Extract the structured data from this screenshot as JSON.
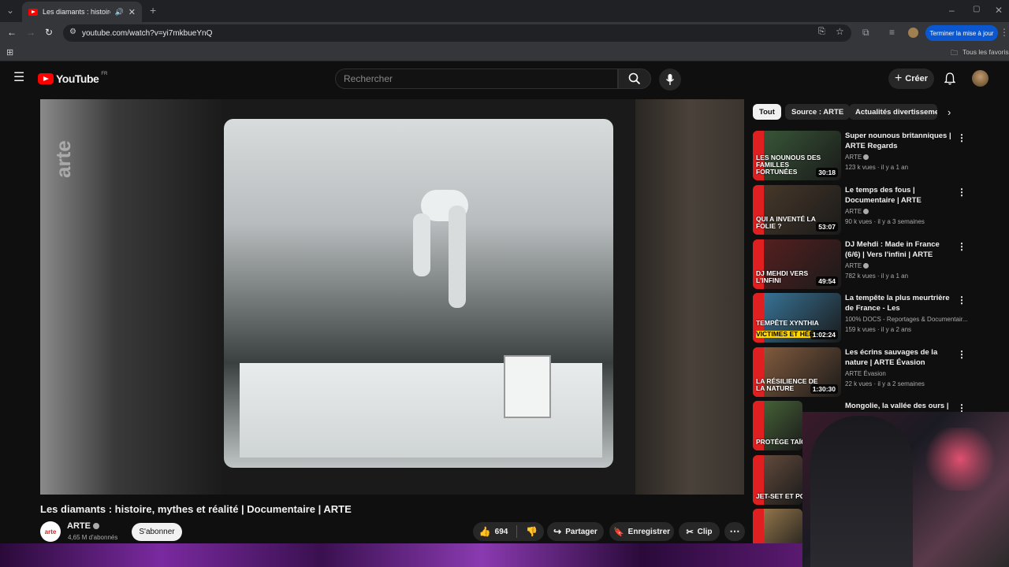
{
  "browser": {
    "tab_title": "Les diamants : histoire, myth",
    "url": "youtube.com/watch?v=yi7mkbueYnQ",
    "update_label": "Terminer la mise à jour",
    "bookmarks_label": "Tous les favoris"
  },
  "header": {
    "logo_text": "YouTube",
    "logo_region": "FR",
    "search_placeholder": "Rechercher",
    "create_label": "Créer"
  },
  "video": {
    "watermark": "arte",
    "title": "Les diamants : histoire, mythes et réalité | Documentaire | ARTE",
    "channel_name": "ARTE",
    "channel_avatar_text": "arte",
    "subscribers": "4,65 M d'abonnés",
    "subscribe_label": "S'abonner",
    "likes": "694",
    "share_label": "Partager",
    "save_label": "Enregistrer",
    "clip_label": "Clip"
  },
  "chips": [
    "Tout",
    "Source : ARTE",
    "Actualités divertissement"
  ],
  "recommendations": [
    {
      "title": "Super nounous britanniques | ARTE Regards",
      "channel": "ARTE",
      "verified": true,
      "meta": "123 k vues · il y a 1 an",
      "duration": "30:18",
      "overlay": "LES NOUNOUS DES FAMILLES FORTUNÉES",
      "bg": "#3a5a3a"
    },
    {
      "title": "Le temps des fous | Documentaire | ARTE",
      "channel": "ARTE",
      "verified": true,
      "meta": "90 k vues · il y a 3 semaines",
      "duration": "53:07",
      "overlay": "QUI A INVENTÉ LA FOLIE ?",
      "bg": "#4a3a2a"
    },
    {
      "title": "DJ Mehdi : Made in France (6/6) | Vers l'infini | ARTE",
      "channel": "ARTE",
      "verified": true,
      "meta": "782 k vues · il y a 1 an",
      "duration": "49:54",
      "overlay": "DJ MEHDI VERS L'INFINI",
      "bg": "#5a2020"
    },
    {
      "title": "La tempête la plus meurtrière de France - Les conséquences...",
      "channel": "100% DOCS - Reportages & Documentair...",
      "verified": false,
      "meta": "159 k vues · il y a 2 ans",
      "duration": "1:02:24",
      "overlay": "TEMPÊTE XYNTHIA",
      "overlay2": "VICTIMES ET HÉR",
      "bg": "#3a7aa0"
    },
    {
      "title": "Les écrins sauvages de la nature | ARTE Évasion",
      "channel": "ARTE Évasion",
      "verified": false,
      "meta": "22 k vues · il y a 2 semaines",
      "duration": "1:30:30",
      "overlay": "LA RÉSILIENCE DE LA NATURE",
      "bg": "#8a6040"
    },
    {
      "title": "Mongolie, la vallée des ours |",
      "channel": "",
      "verified": false,
      "meta": "",
      "duration": "",
      "overlay": "PROTÉGE TAÏGA RO",
      "bg": "#4a6a3a"
    },
    {
      "title": "",
      "channel": "",
      "verified": false,
      "meta": "",
      "duration": "",
      "overlay": "JET-SET ET PORN",
      "bg": "#6a5040"
    },
    {
      "title": "",
      "channel": "",
      "verified": false,
      "meta": "",
      "duration": "",
      "overlay": "",
      "bg": "#a08050"
    }
  ],
  "colors": {
    "accent_red": "#ff0000",
    "arte_red": "#e02020",
    "update_blue": "#0b57d0"
  }
}
